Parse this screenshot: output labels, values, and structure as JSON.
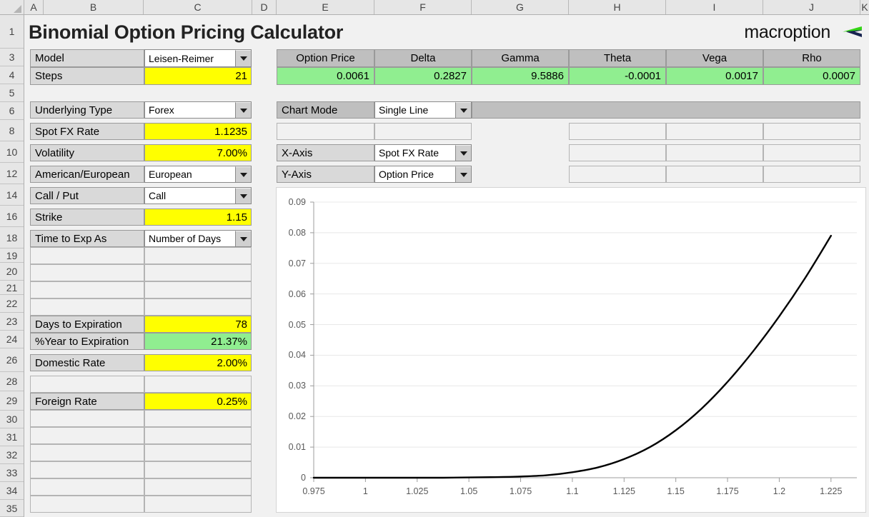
{
  "app": {
    "title": "Binomial Option Pricing Calculator",
    "logo_text": "macroption",
    "logo_icon": "macroption-arrow-icon",
    "logo_green": "#35d417",
    "logo_navy": "#17234f"
  },
  "grid": {
    "columns": [
      "A",
      "B",
      "C",
      "D",
      "E",
      "F",
      "G",
      "H",
      "I",
      "J",
      "K"
    ],
    "rows": [
      "1",
      "3",
      "4",
      "5",
      "6",
      "8",
      "10",
      "12",
      "14",
      "16",
      "18",
      "19",
      "20",
      "21",
      "22",
      "23",
      "24",
      "26",
      "28",
      "29",
      "30",
      "31",
      "32",
      "33",
      "34",
      "35"
    ],
    "select_all_icon": "select-all-triangle-icon"
  },
  "colors": {
    "input_yellow": "#ffff00",
    "output_green": "#90ee90",
    "label_gray": "#d9d9d9",
    "header_gray": "#bfbfbf",
    "sheet_bg": "#f1f1f1",
    "line": "#000000"
  },
  "inputs": {
    "model": {
      "label": "Model",
      "value": "Leisen-Reimer",
      "type": "dropdown"
    },
    "steps": {
      "label": "Steps",
      "value": "21",
      "type": "yellow"
    },
    "underlying_type": {
      "label": "Underlying Type",
      "value": "Forex",
      "type": "dropdown"
    },
    "spot_fx_rate": {
      "label": "Spot FX Rate",
      "value": "1.1235",
      "type": "yellow"
    },
    "volatility": {
      "label": "Volatility",
      "value": "7.00%",
      "type": "yellow"
    },
    "american_european": {
      "label": "American/European",
      "value": "European",
      "type": "dropdown"
    },
    "call_put": {
      "label": "Call / Put",
      "value": "Call",
      "type": "dropdown"
    },
    "strike": {
      "label": "Strike",
      "value": "1.15",
      "type": "yellow"
    },
    "time_to_exp_as": {
      "label": "Time to Exp As",
      "value": "Number of Days",
      "type": "dropdown"
    },
    "days_to_expiration": {
      "label": "Days to Expiration",
      "value": "78",
      "type": "yellow"
    },
    "pct_year_to_expiration": {
      "label": "%Year to Expiration",
      "value": "21.37%",
      "type": "green"
    },
    "domestic_rate": {
      "label": "Domestic Rate",
      "value": "2.00%",
      "type": "yellow"
    },
    "foreign_rate": {
      "label": "Foreign Rate",
      "value": "0.25%",
      "type": "yellow"
    }
  },
  "results": {
    "headers": [
      "Option Price",
      "Delta",
      "Gamma",
      "Theta",
      "Vega",
      "Rho"
    ],
    "values": [
      "0.0061",
      "0.2827",
      "9.5886",
      "-0.0001",
      "0.0017",
      "0.0007"
    ]
  },
  "chart_controls": {
    "chart_mode": {
      "label": "Chart Mode",
      "value": "Single Line"
    },
    "x_axis": {
      "label": "X-Axis",
      "value": "Spot FX Rate"
    },
    "y_axis": {
      "label": "Y-Axis",
      "value": "Option Price"
    }
  },
  "chart_data": {
    "type": "line",
    "title": "",
    "xlabel": "",
    "ylabel": "",
    "xlim": [
      0.975,
      1.2375
    ],
    "ylim": [
      0,
      0.09
    ],
    "grid": true,
    "legend": false,
    "x_ticks": [
      "0.975",
      "1",
      "1.025",
      "1.05",
      "1.075",
      "1.1",
      "1.125",
      "1.15",
      "1.175",
      "1.2",
      "1.225"
    ],
    "y_ticks": [
      "0",
      "0.01",
      "0.02",
      "0.03",
      "0.04",
      "0.05",
      "0.06",
      "0.07",
      "0.08",
      "0.09"
    ],
    "series": [
      {
        "name": "Option Price",
        "color": "#000000",
        "x": [
          0.975,
          0.9875,
          1.0,
          1.0125,
          1.025,
          1.0375,
          1.05,
          1.0625,
          1.075,
          1.0875,
          1.1,
          1.1125,
          1.125,
          1.1375,
          1.15,
          1.1625,
          1.175,
          1.1875,
          1.2,
          1.2125,
          1.225
        ],
        "y": [
          0.0,
          0.0,
          0.0,
          0.0,
          0.0,
          0.0,
          0.0001,
          0.0002,
          0.0004,
          0.0008,
          0.0018,
          0.0034,
          0.0061,
          0.01,
          0.0155,
          0.0226,
          0.0313,
          0.0414,
          0.0527,
          0.0652,
          0.079
        ]
      }
    ]
  }
}
